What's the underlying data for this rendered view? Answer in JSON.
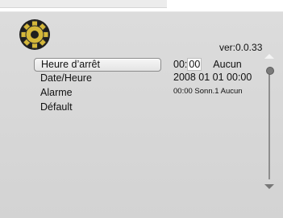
{
  "version": "ver:0.0.33",
  "menu": {
    "items": [
      {
        "label": "Heure d’arrêt",
        "selected": true
      },
      {
        "label": "Date/Heure",
        "selected": false
      },
      {
        "label": "Alarme",
        "selected": false
      },
      {
        "label": "Défault",
        "selected": false
      }
    ]
  },
  "values": {
    "stop_time": {
      "hours": "00:",
      "minutes": "00",
      "mode": "Aucun"
    },
    "date_time": "2008 01 01 00:00",
    "alarm": "00:00 Sonn.1 Aucun"
  },
  "icons": {
    "settings": "gear-icon",
    "scroll_up": "triangle-up-icon",
    "scroll_down": "triangle-down-icon"
  },
  "colors": {
    "panel_bg": "#d8d8d8",
    "gear_fill": "#d4b73a",
    "gear_outline": "#2b2b2b",
    "selection_border": "#8c8c8c"
  }
}
